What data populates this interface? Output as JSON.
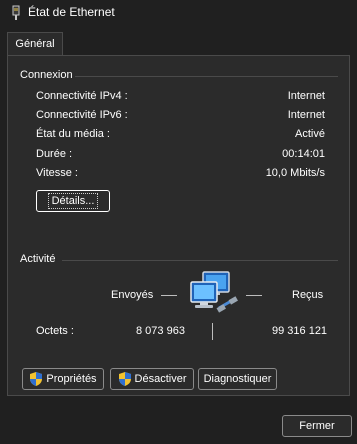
{
  "window": {
    "title": "État de Ethernet"
  },
  "tabs": [
    {
      "label": "Général"
    }
  ],
  "connexion": {
    "title": "Connexion",
    "rows": [
      {
        "label": "Connectivité IPv4 :",
        "value": "Internet"
      },
      {
        "label": "Connectivité IPv6 :",
        "value": "Internet"
      },
      {
        "label": "État du média :",
        "value": "Activé"
      },
      {
        "label": "Durée :",
        "value": "00:14:01"
      },
      {
        "label": "Vitesse :",
        "value": "10,0 Mbits/s"
      }
    ],
    "details_button": "Détails..."
  },
  "activite": {
    "title": "Activité",
    "sent_label": "Envoyés",
    "received_label": "Reçus",
    "octets_label": "Octets :",
    "octets_sent": "8 073 963",
    "octets_received": "99 316 121"
  },
  "buttons": {
    "proprietes": "Propriétés",
    "desactiver": "Désactiver",
    "diagnostiquer": "Diagnostiquer",
    "fermer": "Fermer"
  },
  "icons": {
    "window_icon": "network-adapter-icon",
    "activity_icon": "network-computers-icon",
    "shield_icon": "uac-shield-icon"
  }
}
